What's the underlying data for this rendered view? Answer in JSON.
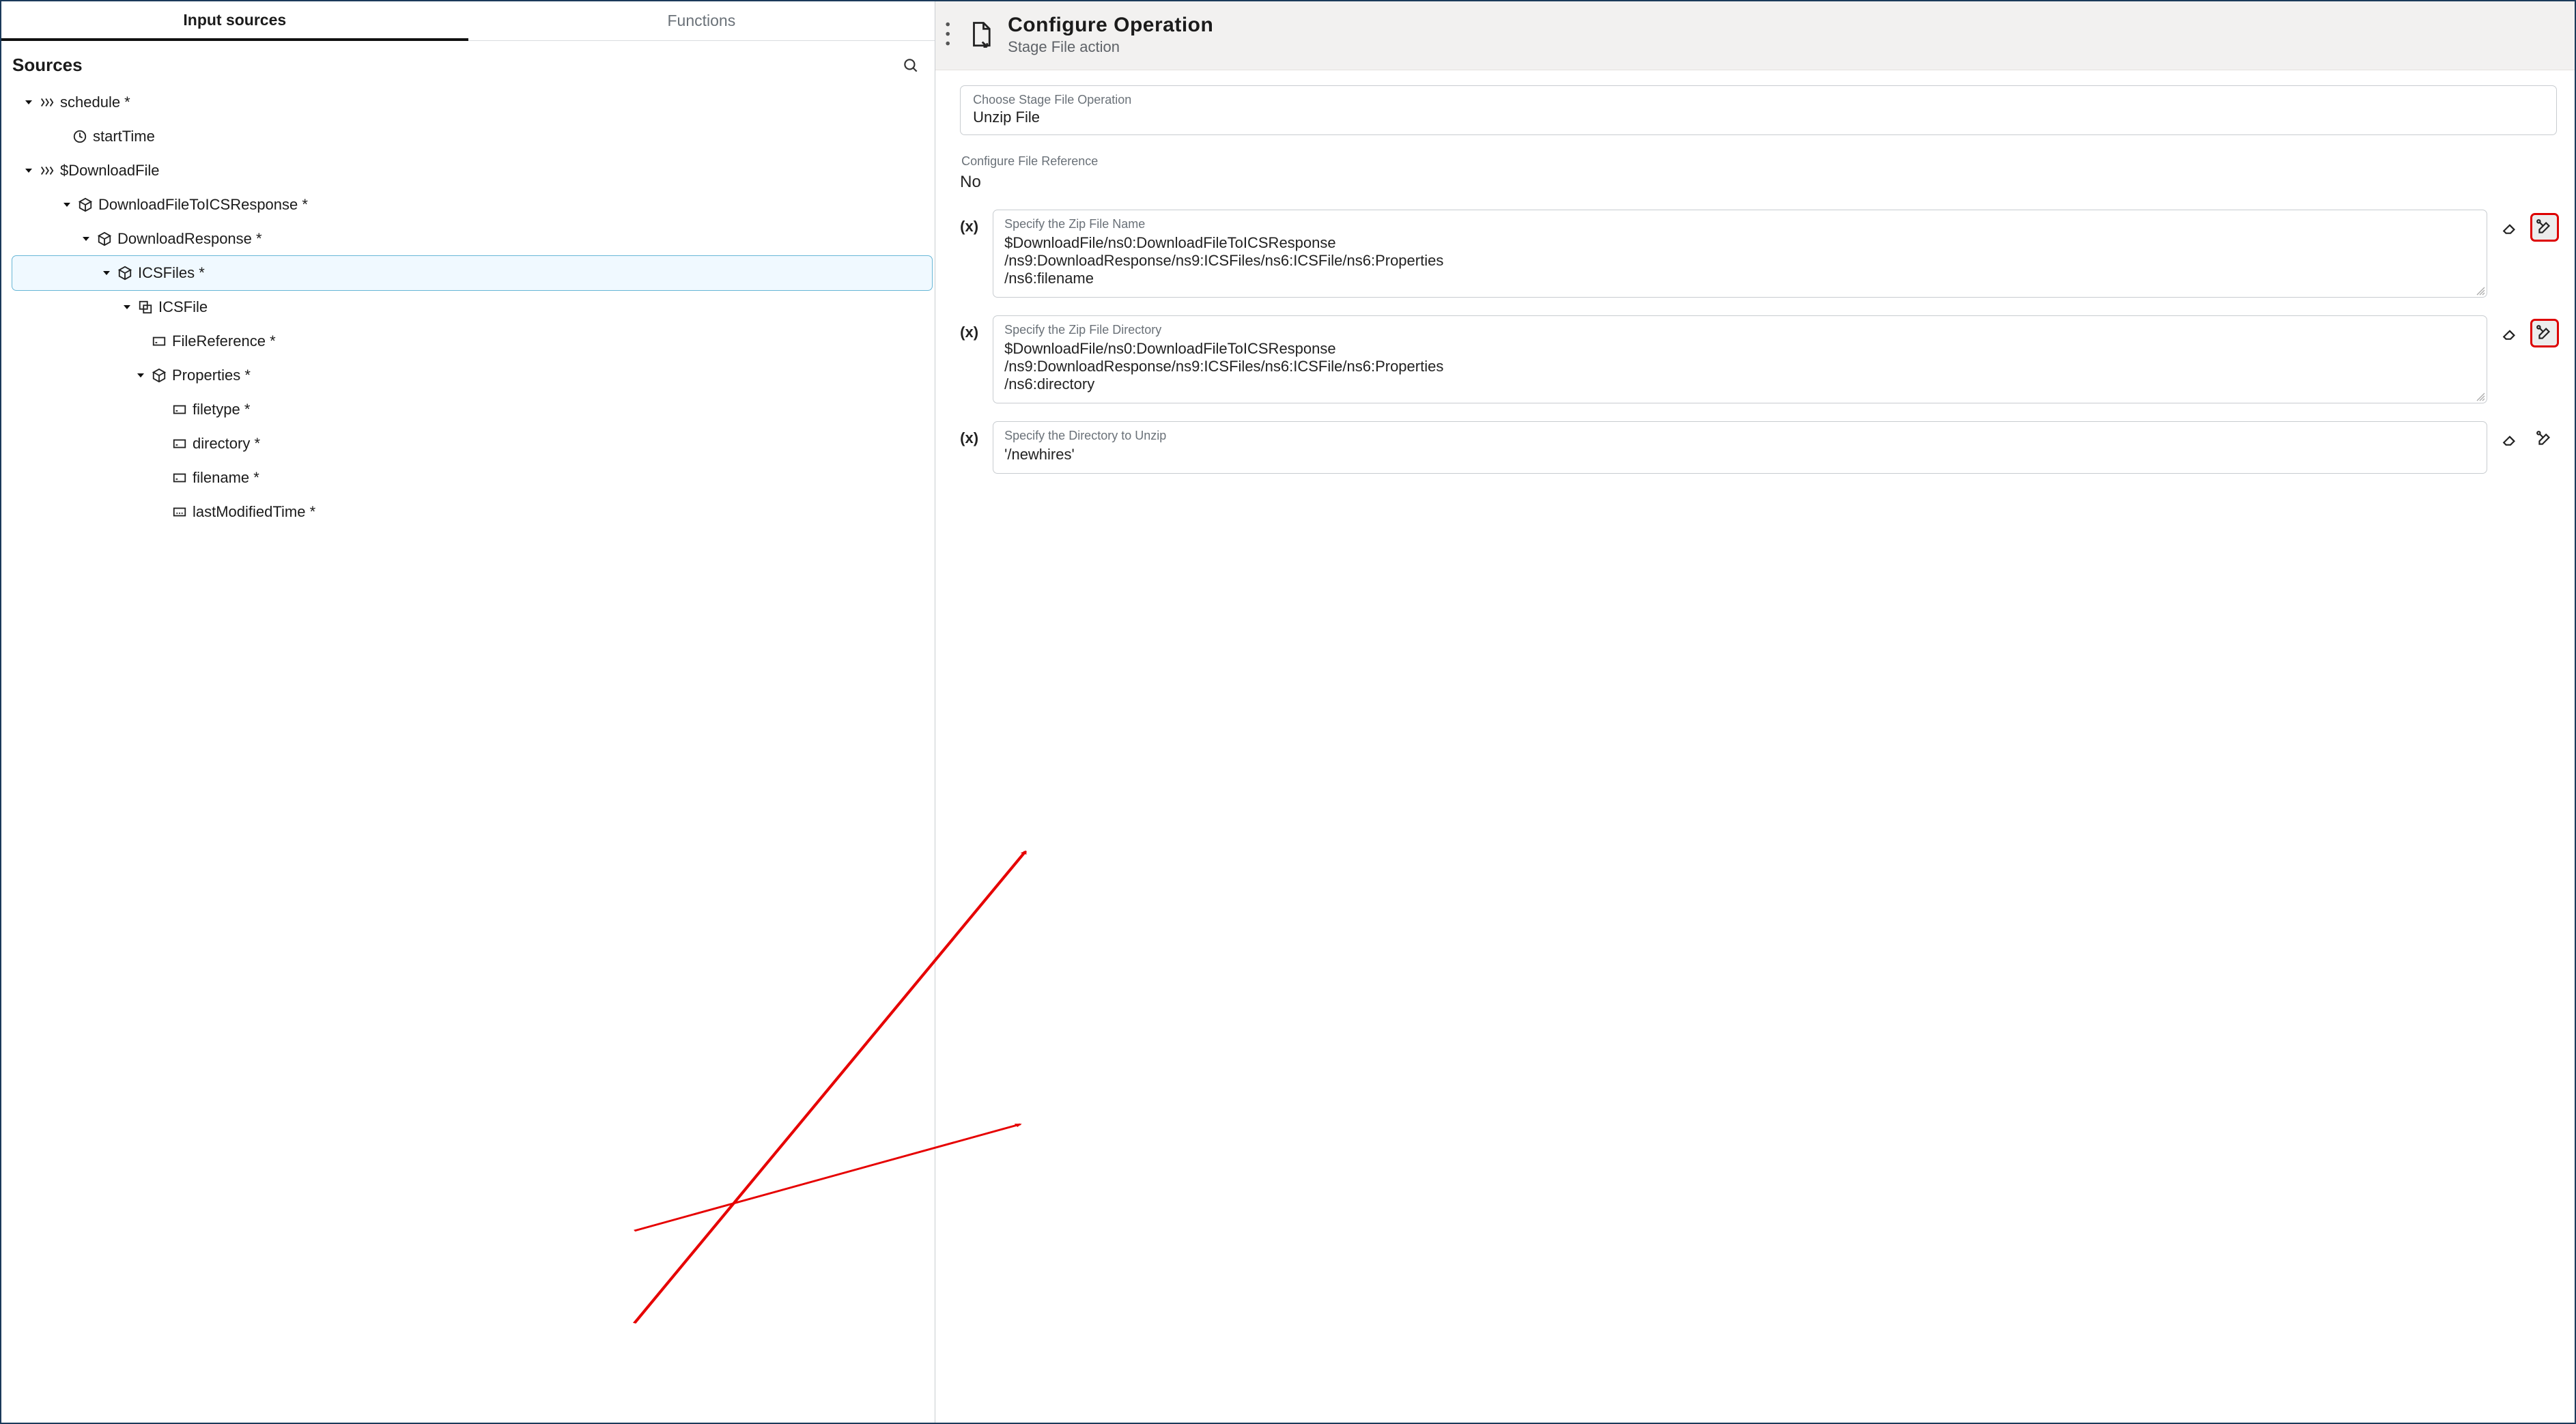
{
  "tabs": {
    "input": "Input sources",
    "functions": "Functions"
  },
  "sources_heading": "Sources",
  "tree": {
    "n0": "schedule *",
    "n1": "startTime",
    "n2": "$DownloadFile",
    "n3": "DownloadFileToICSResponse *",
    "n4": "DownloadResponse *",
    "n5": "ICSFiles *",
    "n6": "ICSFile",
    "n7": "FileReference *",
    "n8": "Properties *",
    "n9": "filetype *",
    "n10": "directory *",
    "n11": "filename *",
    "n12": "lastModifiedTime *"
  },
  "header": {
    "title": "Configure Operation",
    "subtitle": "Stage File action"
  },
  "operation": {
    "choose_label": "Choose Stage File Operation",
    "choose_value": "Unzip File",
    "file_ref_label": "Configure File Reference",
    "file_ref_value": "No"
  },
  "fields": {
    "xlabel": "(x)",
    "f1_label": "Specify the Zip File Name",
    "f1_value": "$DownloadFile/ns0:DownloadFileToICSResponse\n/ns9:DownloadResponse/ns9:ICSFiles/ns6:ICSFile/ns6:Properties\n/ns6:filename",
    "f2_label": "Specify the Zip File Directory",
    "f2_value": "$DownloadFile/ns0:DownloadFileToICSResponse\n/ns9:DownloadResponse/ns9:ICSFiles/ns6:ICSFile/ns6:Properties\n/ns6:directory",
    "f3_label": "Specify the Directory to Unzip",
    "f3_value": "'/newhires'"
  }
}
